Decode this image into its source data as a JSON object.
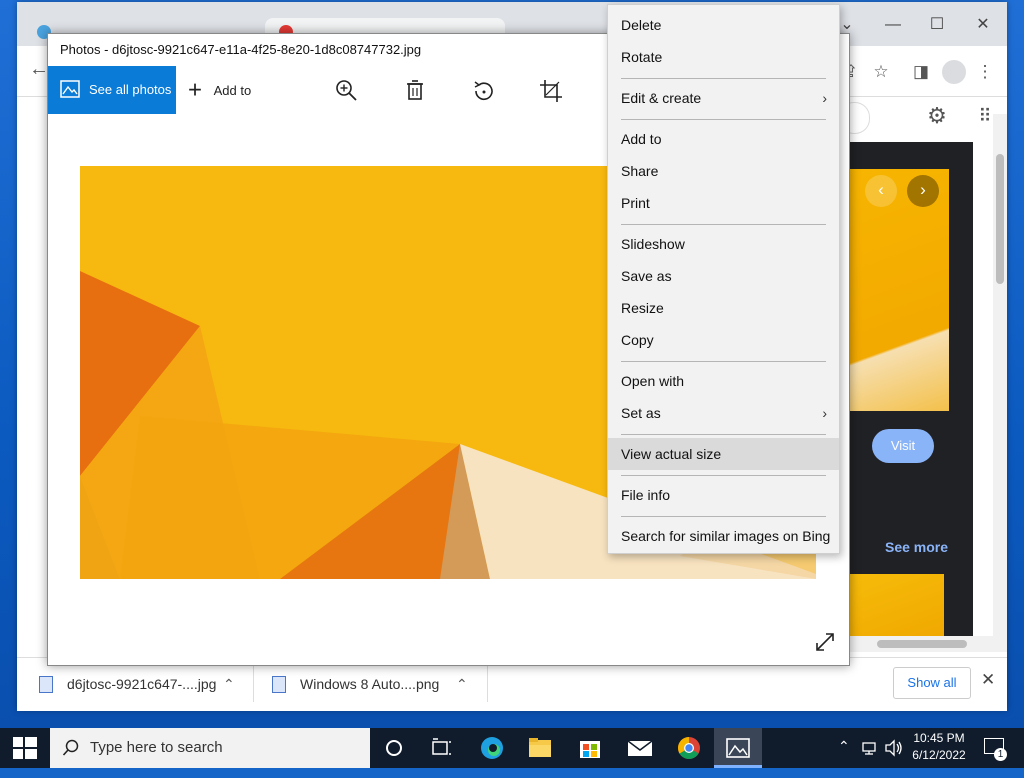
{
  "photos_window": {
    "title": "Photos - d6jtosc-9921c647-e11a-4f25-8e20-1d8c08747732.jpg",
    "toolbar": {
      "see_all": "See all photos",
      "add_to": "Add to"
    }
  },
  "context_menu": {
    "items": [
      {
        "label": "Delete"
      },
      {
        "label": "Rotate"
      },
      {
        "label": "Edit & create"
      },
      {
        "label": "Add to"
      },
      {
        "label": "Share"
      },
      {
        "label": "Print"
      },
      {
        "label": "Slideshow"
      },
      {
        "label": "Save as"
      },
      {
        "label": "Resize"
      },
      {
        "label": "Copy"
      },
      {
        "label": "Open with"
      },
      {
        "label": "Set as"
      },
      {
        "label": "View actual size"
      },
      {
        "label": "File info"
      },
      {
        "label": "Search for similar images on Bing"
      }
    ],
    "highlighted": "View actual size"
  },
  "browser": {
    "visit_label": "Visit",
    "see_more_label": "See more",
    "downloads": [
      {
        "name": "d6jtosc-9921c647-....jpg"
      },
      {
        "name": "Windows 8 Auto....png"
      }
    ],
    "show_all": "Show all"
  },
  "taskbar": {
    "search_placeholder": "Type here to search",
    "time": "10:45 PM",
    "date": "6/12/2022",
    "notification_count": "1"
  },
  "colors": {
    "accent": "#0a7bd6",
    "menu_bg": "#f2f2f2",
    "menu_highlight": "#dadada",
    "taskbar": "#101c2c"
  }
}
